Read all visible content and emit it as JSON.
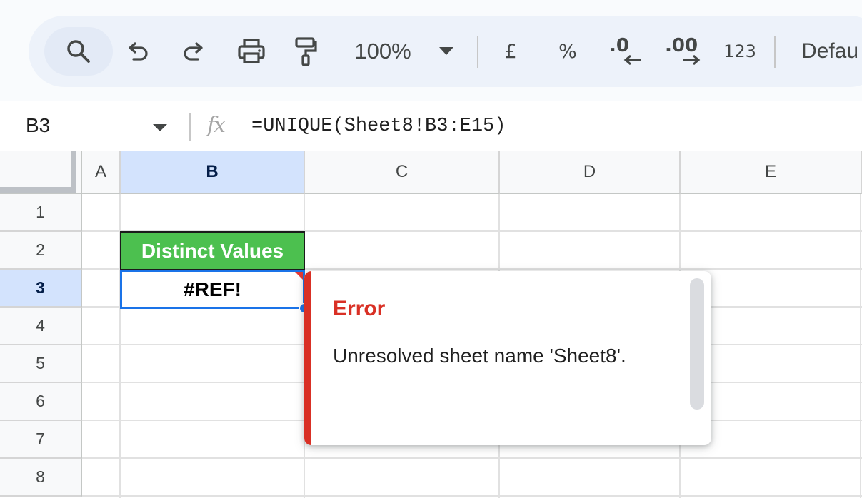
{
  "toolbar": {
    "zoom": "100%",
    "currency": "£",
    "percent": "%",
    "decrease_decimal": ".0",
    "increase_decimal": ".00",
    "number_format": "123",
    "font": "Defau"
  },
  "formula_bar": {
    "name_box": "B3",
    "fx": "fx",
    "formula": "=UNIQUE(Sheet8!B3:E15)"
  },
  "columns": [
    "A",
    "B",
    "C",
    "D",
    "E"
  ],
  "rows": [
    "1",
    "2",
    "3",
    "4",
    "5",
    "6",
    "7",
    "8"
  ],
  "cells": {
    "B2": "Distinct Values",
    "B3": "#REF!"
  },
  "error_popup": {
    "title": "Error",
    "message": "Unresolved sheet name 'Sheet8'."
  },
  "colors": {
    "header_fill": "#4cc04f",
    "selection": "#1a73e8",
    "error": "#d93025"
  }
}
